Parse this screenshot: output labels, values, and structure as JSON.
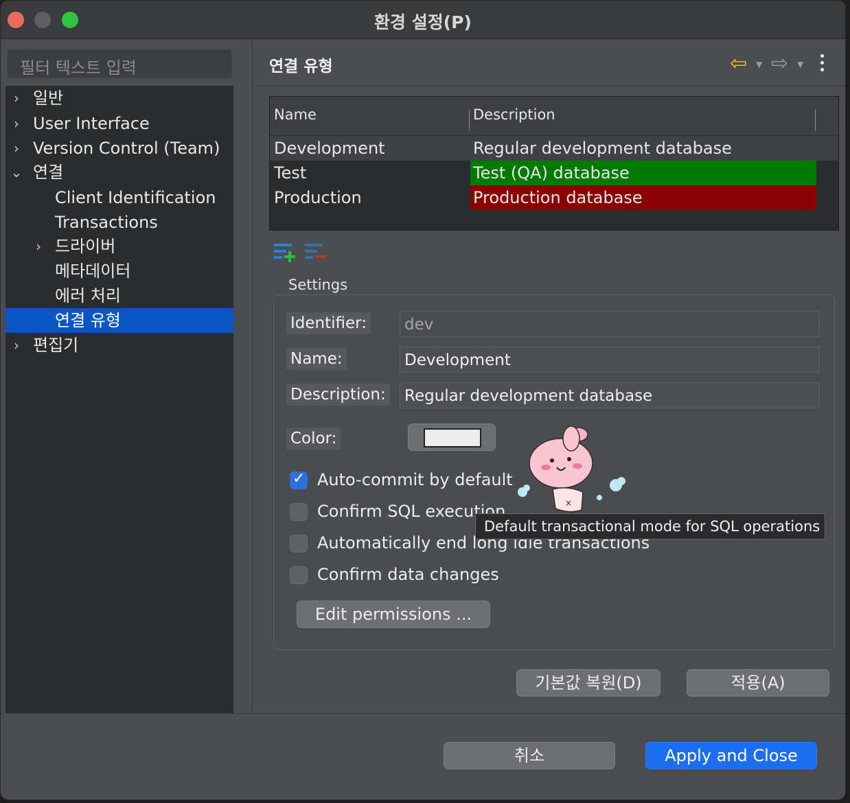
{
  "window": {
    "title": "환경 설정(P)"
  },
  "sidebar": {
    "filter_placeholder": "필터 텍스트 입력",
    "items": [
      {
        "label": "일반",
        "expander": "›"
      },
      {
        "label": "User Interface",
        "expander": "›"
      },
      {
        "label": "Version Control (Team)",
        "expander": "›"
      },
      {
        "label": "연결",
        "expander": "⌄"
      },
      {
        "label": "Client Identification"
      },
      {
        "label": "Transactions"
      },
      {
        "label": "드라이버",
        "expander": "›"
      },
      {
        "label": "메타데이터"
      },
      {
        "label": "에러 처리"
      },
      {
        "label": "연결 유형",
        "selected": true
      },
      {
        "label": "편집기",
        "expander": "›"
      }
    ]
  },
  "page": {
    "title": "연결 유형",
    "nav": {
      "back_icon": "arrow-left-icon",
      "forward_icon": "arrow-right-icon",
      "menu_icon": "kebab-menu-icon"
    }
  },
  "table": {
    "headers": [
      "Name",
      "Description"
    ],
    "rows": [
      {
        "name": "Development",
        "description": "Regular development database",
        "color": ""
      },
      {
        "name": "Test",
        "description": "Test (QA) database",
        "color": "#007a00"
      },
      {
        "name": "Production",
        "description": "Production database",
        "color": "#8b0000"
      }
    ]
  },
  "settings": {
    "title": "Settings",
    "identifier_label": "Identifier:",
    "identifier_value": "dev",
    "name_label": "Name:",
    "name_value": "Development",
    "description_label": "Description:",
    "description_value": "Regular development database",
    "color_label": "Color:",
    "color_value": "#ececec",
    "checks": [
      {
        "label": "Auto-commit by default",
        "checked": true
      },
      {
        "label": "Confirm SQL execution",
        "checked": false
      },
      {
        "label": "Automatically end long idle transactions",
        "checked": false
      },
      {
        "label": "Confirm data changes",
        "checked": false
      }
    ],
    "edit_permissions": "Edit permissions ..."
  },
  "buttons": {
    "restore_defaults": "기본값 복원(D)",
    "apply": "적용(A)",
    "cancel": "취소",
    "apply_close": "Apply and Close"
  },
  "tooltip": "Default transactional mode for SQL operations",
  "colors": {
    "accent": "#1a6ff0",
    "selection": "#0a56c9",
    "test_row": "#007a00",
    "production_row": "#8b0000"
  }
}
